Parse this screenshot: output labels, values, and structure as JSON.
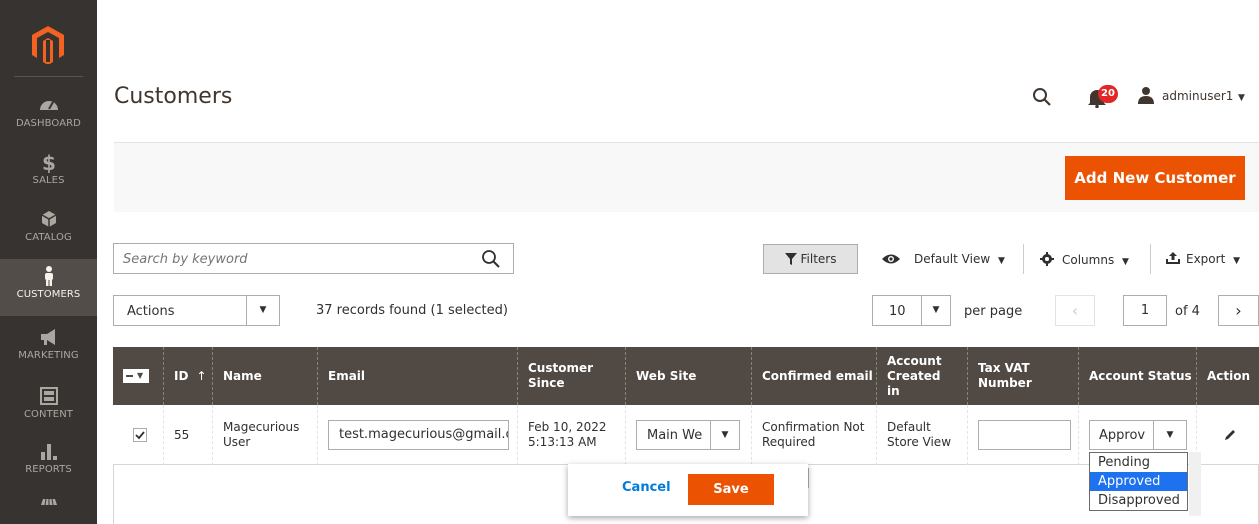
{
  "sidebar": {
    "items": [
      {
        "label": "DASHBOARD",
        "icon": "dashboard-icon"
      },
      {
        "label": "SALES",
        "icon": "dollar-icon"
      },
      {
        "label": "CATALOG",
        "icon": "cube-icon"
      },
      {
        "label": "CUSTOMERS",
        "icon": "person-icon",
        "active": true
      },
      {
        "label": "MARKETING",
        "icon": "megaphone-icon"
      },
      {
        "label": "CONTENT",
        "icon": "content-icon"
      },
      {
        "label": "REPORTS",
        "icon": "bar-chart-icon"
      },
      {
        "label": "",
        "icon": "store-icon"
      }
    ]
  },
  "header": {
    "title": "Customers",
    "notifications_count": "20",
    "username": "adminuser1"
  },
  "action_bar": {
    "add_label": "Add New Customer"
  },
  "toolbar": {
    "search_placeholder": "Search by keyword",
    "filters_label": "Filters",
    "view_label": "Default View",
    "columns_label": "Columns",
    "export_label": "Export",
    "actions_label": "Actions",
    "records_text": "37 records found (1 selected)",
    "per_page_value": "10",
    "per_page_label": "per page",
    "current_page": "1",
    "of_pages": "of 4"
  },
  "grid": {
    "headers": {
      "id": "ID",
      "id_sort": "↑",
      "name": "Name",
      "email": "Email",
      "customer_since": "Customer Since",
      "website": "Web Site",
      "confirmed_email": "Confirmed email",
      "account_created_in": "Account Created in",
      "tax_vat": "Tax VAT Number",
      "account_status": "Account Status",
      "action": "Action"
    },
    "row": {
      "id": "55",
      "name": "Magecurious User",
      "email": "test.magecurious@gmail.com",
      "customer_since": "Feb 10, 2022 5:13:13 AM",
      "website": "Main We",
      "confirmed_email": "Confirmation Not Required",
      "account_created_in": "Default Store View",
      "tax_vat": "",
      "account_status": "Approv"
    }
  },
  "inline_edit": {
    "cancel_label": "Cancel",
    "save_label": "Save"
  },
  "status_options": [
    "Pending",
    "Approved",
    "Disapproved"
  ],
  "colors": {
    "accent": "#eb5202",
    "sidebar_bg": "#373330",
    "grid_header_bg": "#514943",
    "link": "#007bdb",
    "selection": "#1e72f0",
    "badge": "#e22626"
  }
}
